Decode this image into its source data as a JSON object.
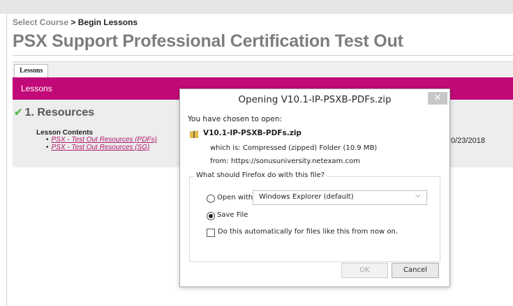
{
  "breadcrumb": {
    "link": "Select Course",
    "separator": " > ",
    "current": "Begin Lessons"
  },
  "page": {
    "title": "PSX Support Professional Certification Test Out"
  },
  "tabs": [
    {
      "label": "Lessons"
    }
  ],
  "section": {
    "header": "Lessons"
  },
  "resources": {
    "title": "1. Resources",
    "contents_label": "Lesson Contents",
    "items": [
      {
        "label": "PSX - Test Out Resources (PDFs)"
      },
      {
        "label": "PSX - Test Out Resources (SG)"
      }
    ],
    "date": "0/23/2018"
  },
  "dialog": {
    "title": "Opening V10.1-IP-PSXB-PDFs.zip",
    "close": "✕",
    "chosen_text": "You have chosen to open:",
    "file_name": "V10.1-IP-PSXB-PDFs.zip",
    "which_is": "which is: Compressed (zipped) Folder (10.9 MB)",
    "from": "from: https://sonusuniversity.netexam.com",
    "group_label": "What should Firefox do with this file?",
    "open_with_label": "Open with",
    "open_with_value": "Windows Explorer (default)",
    "save_label": "Save File",
    "save_selected": true,
    "auto_label": "Do this automatically for files like this from now on.",
    "ok": "OK",
    "cancel": "Cancel"
  },
  "colors": {
    "accent": "#c10a77",
    "link": "#b0176f",
    "check": "#5bb55b"
  },
  "icons": {
    "check": "checkmark-icon",
    "folder": "zip-folder-icon",
    "caret": "chevron-down-icon"
  }
}
